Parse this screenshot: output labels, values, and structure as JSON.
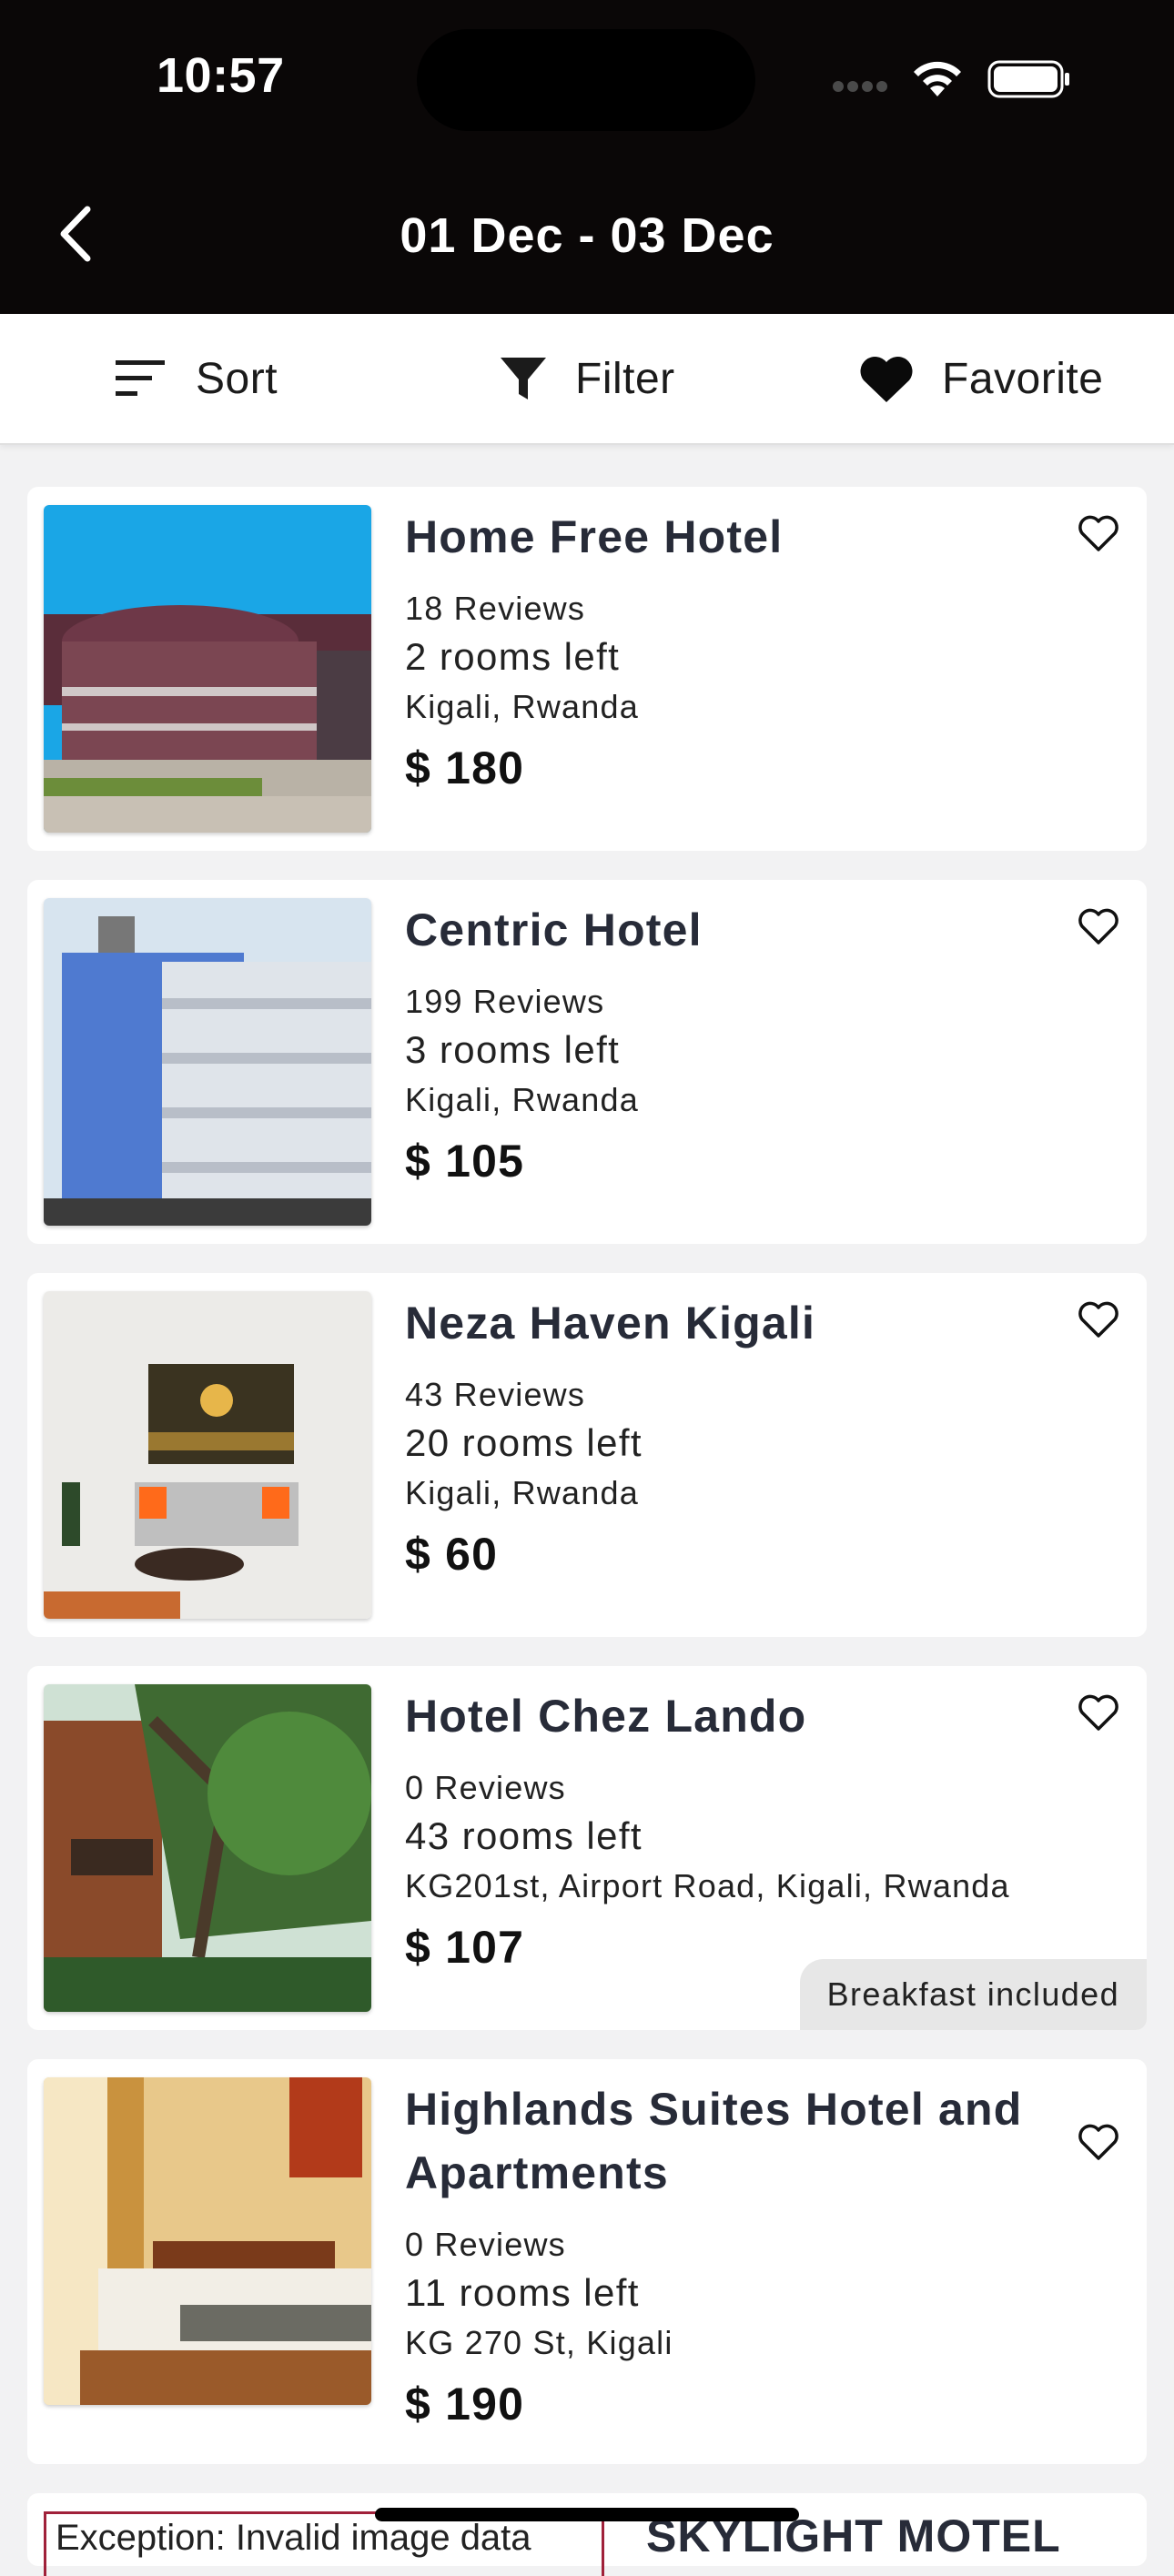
{
  "status_bar": {
    "time": "10:57"
  },
  "header": {
    "title": "01 Dec - 03 Dec",
    "back_icon": "chevron-left-icon"
  },
  "toolbar": {
    "sort_label": "Sort",
    "filter_label": "Filter",
    "favorite_label": "Favorite"
  },
  "hotels": [
    {
      "name": "Home Free Hotel",
      "reviews": "18 Reviews",
      "rooms": "2 rooms left",
      "location": "Kigali, Rwanda",
      "price": "$ 180"
    },
    {
      "name": "Centric Hotel",
      "reviews": "199 Reviews",
      "rooms": "3 rooms left",
      "location": "Kigali, Rwanda",
      "price": "$ 105"
    },
    {
      "name": "Neza Haven Kigali",
      "reviews": "43 Reviews",
      "rooms": "20 rooms left",
      "location": "Kigali, Rwanda",
      "price": "$ 60"
    },
    {
      "name": "Hotel Chez Lando",
      "reviews": "0 Reviews",
      "rooms": "43 rooms left",
      "location": "KG201st, Airport Road, Kigali, Rwanda",
      "price": "$ 107",
      "badge": "Breakfast included"
    },
    {
      "name": "Highlands Suites Hotel and Apartments",
      "reviews": "0 Reviews",
      "rooms": "11 rooms left",
      "location": "KG 270 St, Kigali",
      "price": "$ 190"
    }
  ],
  "partial_card": {
    "name": "SKYLIGHT MOTEL",
    "image_error": "Exception: Invalid image data"
  },
  "colors": {
    "header_bg": "#0a0707",
    "page_bg": "#f2f2f3",
    "card_bg": "#ffffff",
    "badge_bg": "#e7e7e7"
  }
}
